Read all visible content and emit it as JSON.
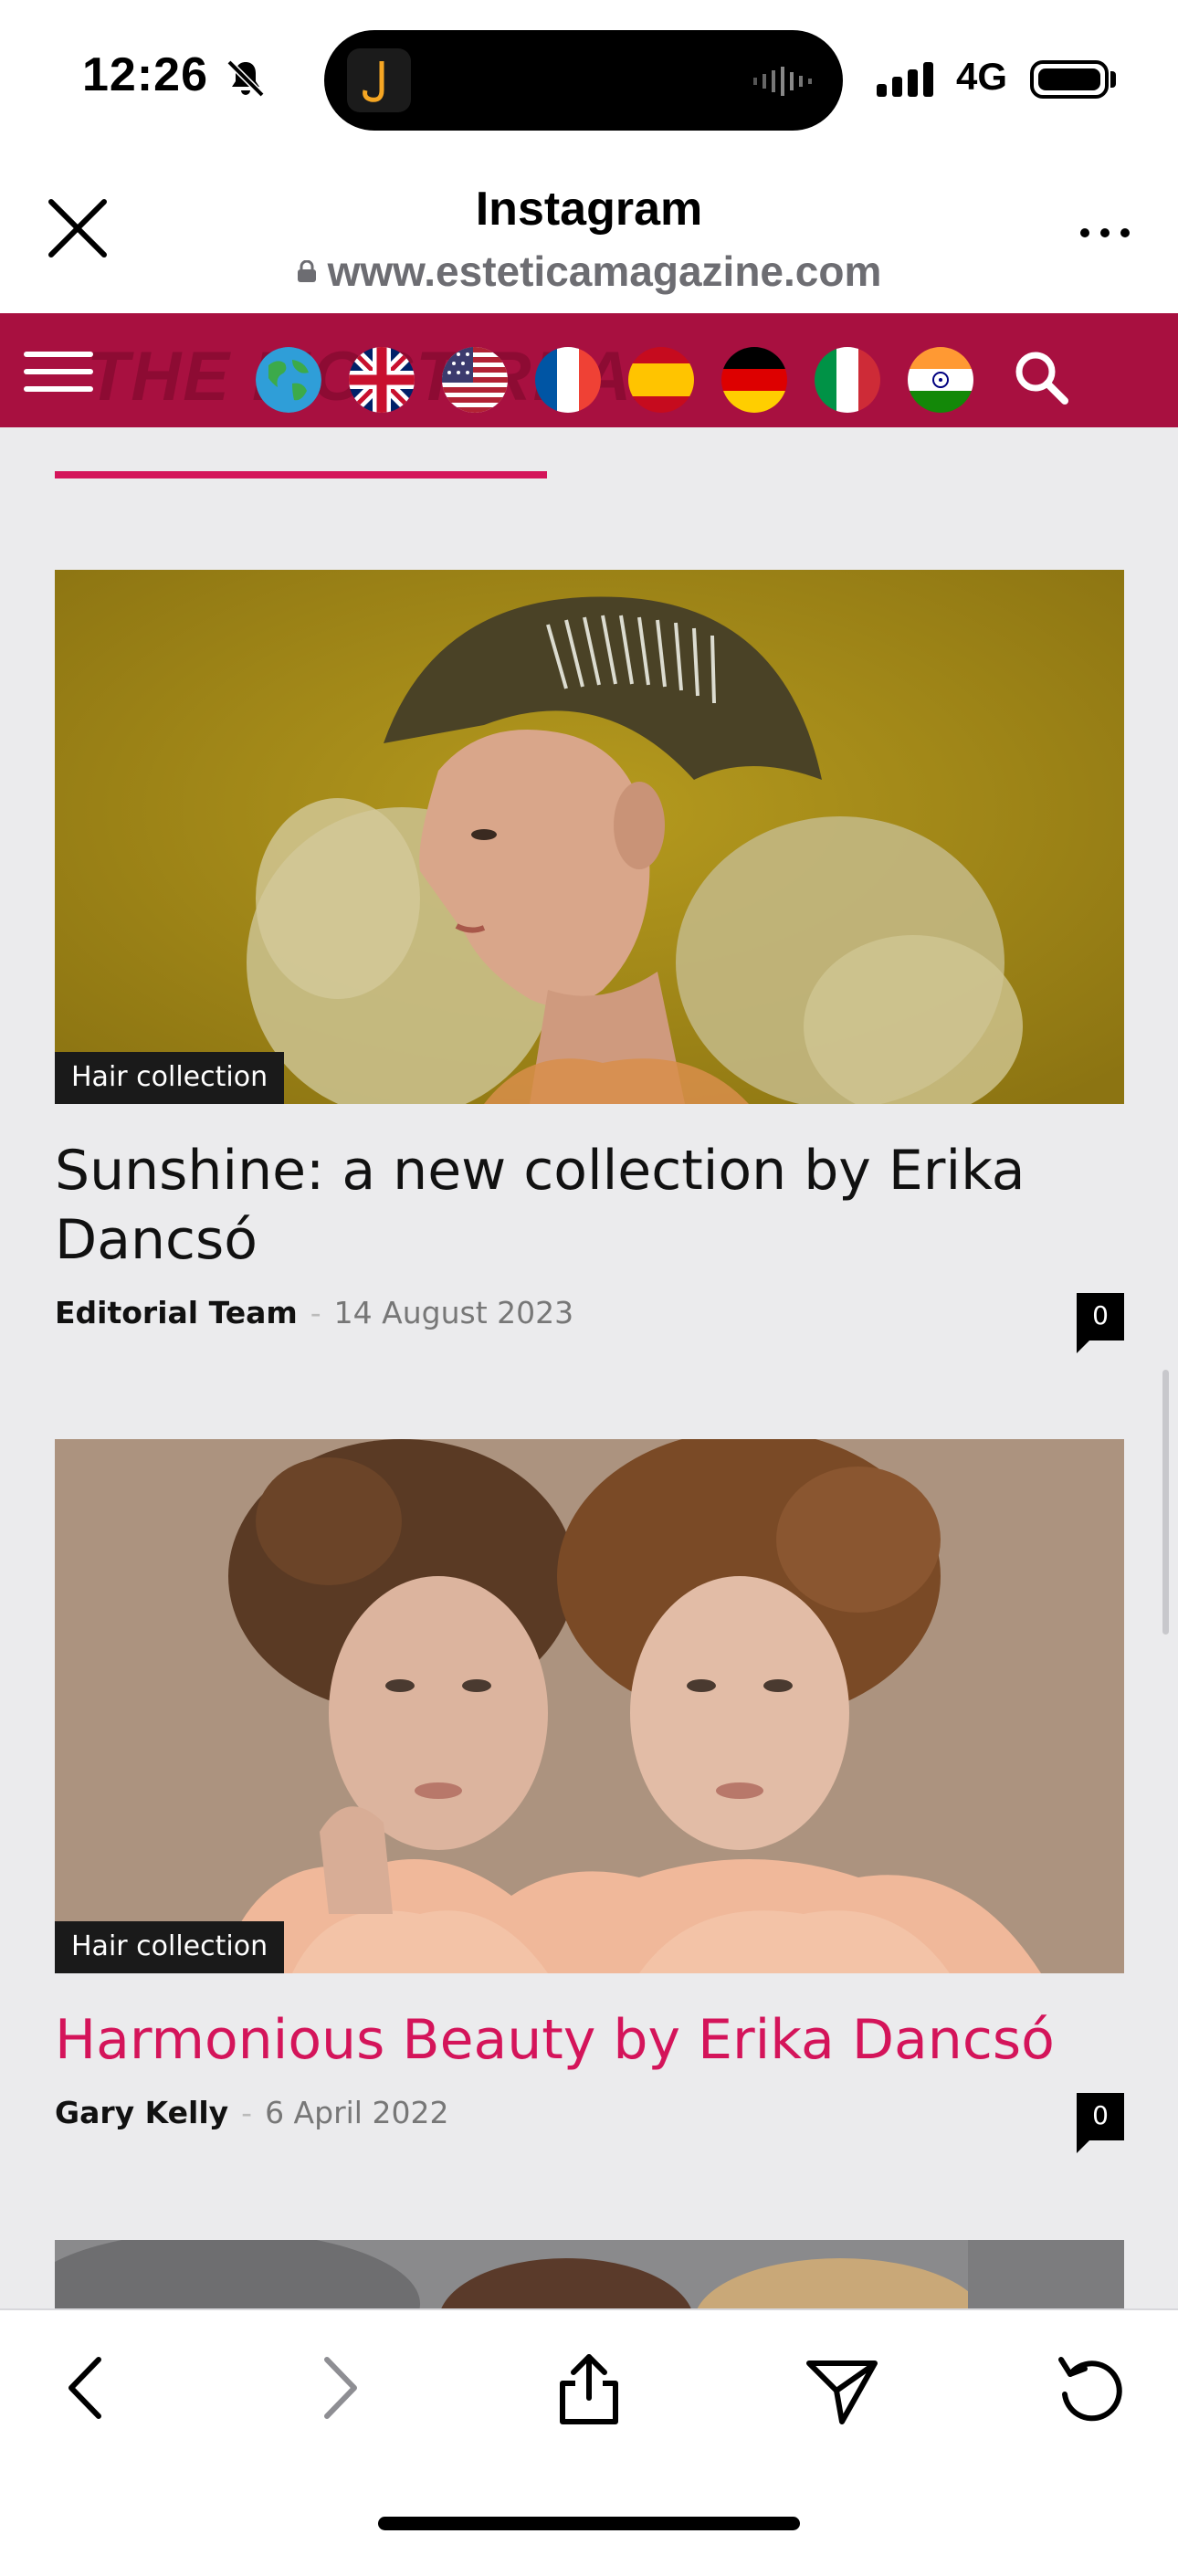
{
  "status_bar": {
    "time": "12:26",
    "network": "4G",
    "icons": [
      "bell-slash-icon",
      "signal-icon",
      "battery-icon"
    ]
  },
  "browser": {
    "title": "Instagram",
    "url": "www.esteticamagazine.com",
    "icons": [
      "close-icon",
      "lock-icon",
      "more-icon"
    ]
  },
  "site_nav": {
    "background": "#a81040",
    "watermark": "THE MOST READ",
    "flags": [
      "globe",
      "uk",
      "usa",
      "france",
      "spain",
      "germany",
      "italy",
      "india"
    ],
    "icons": [
      "menu-icon",
      "search-icon"
    ]
  },
  "articles": [
    {
      "category": "Hair collection",
      "title": "Sunshine: a new collection by Erika Dancsó",
      "author": "Editorial Team",
      "date": "14 August 2023",
      "comments": "0"
    },
    {
      "category": "Hair collection",
      "title": "Harmonious Beauty by Erika Dancsó",
      "author": "Gary Kelly",
      "date": "6 April 2022",
      "comments": "0"
    }
  ],
  "toolbar": {
    "icons": [
      "back-icon",
      "forward-icon",
      "share-icon",
      "send-icon",
      "reload-icon"
    ]
  },
  "colors": {
    "accent": "#d4145a",
    "nav": "#a81040"
  }
}
